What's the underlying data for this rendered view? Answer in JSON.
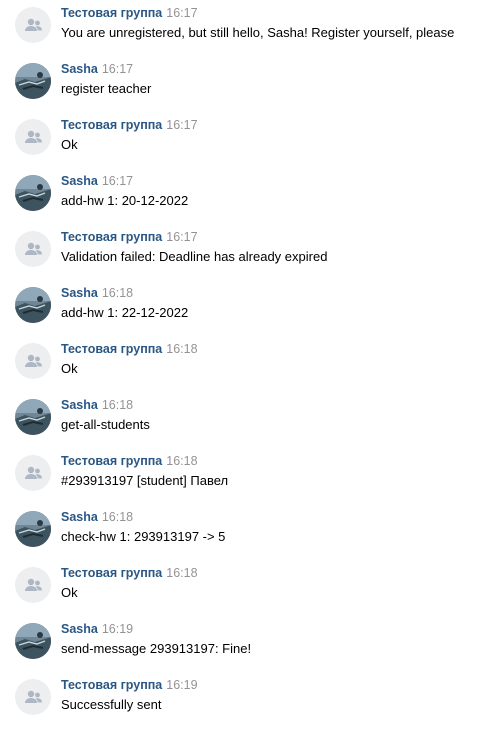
{
  "messages": [
    {
      "author": "Тестовая группа",
      "kind": "group",
      "time": "16:17",
      "text": "You are unregistered, but still hello, Sasha! Register yourself, please"
    },
    {
      "author": "Sasha",
      "kind": "user",
      "time": "16:17",
      "text": "register teacher"
    },
    {
      "author": "Тестовая группа",
      "kind": "group",
      "time": "16:17",
      "text": "Ok"
    },
    {
      "author": "Sasha",
      "kind": "user",
      "time": "16:17",
      "text": "add-hw 1: 20-12-2022"
    },
    {
      "author": "Тестовая группа",
      "kind": "group",
      "time": "16:17",
      "text": "Validation failed: Deadline has already expired"
    },
    {
      "author": "Sasha",
      "kind": "user",
      "time": "16:18",
      "text": "add-hw 1: 22-12-2022"
    },
    {
      "author": "Тестовая группа",
      "kind": "group",
      "time": "16:18",
      "text": "Ok"
    },
    {
      "author": "Sasha",
      "kind": "user",
      "time": "16:18",
      "text": "get-all-students"
    },
    {
      "author": "Тестовая группа",
      "kind": "group",
      "time": "16:18",
      "text": "#293913197 [student] Павел"
    },
    {
      "author": "Sasha",
      "kind": "user",
      "time": "16:18",
      "text": "check-hw 1: 293913197 -> 5"
    },
    {
      "author": "Тестовая группа",
      "kind": "group",
      "time": "16:18",
      "text": "Ok"
    },
    {
      "author": "Sasha",
      "kind": "user",
      "time": "16:19",
      "text": "send-message 293913197: Fine!"
    },
    {
      "author": "Тестовая группа",
      "kind": "group",
      "time": "16:19",
      "text": "Successfully sent"
    }
  ],
  "icons": {
    "group_avatar": "group-people-icon",
    "user_avatar": "user-photo-avatar"
  },
  "colors": {
    "author": "#2a5885",
    "time": "#939393",
    "text": "#000000",
    "group_avatar_bg": "#edeef0",
    "group_avatar_icon": "#aeb7c2"
  }
}
